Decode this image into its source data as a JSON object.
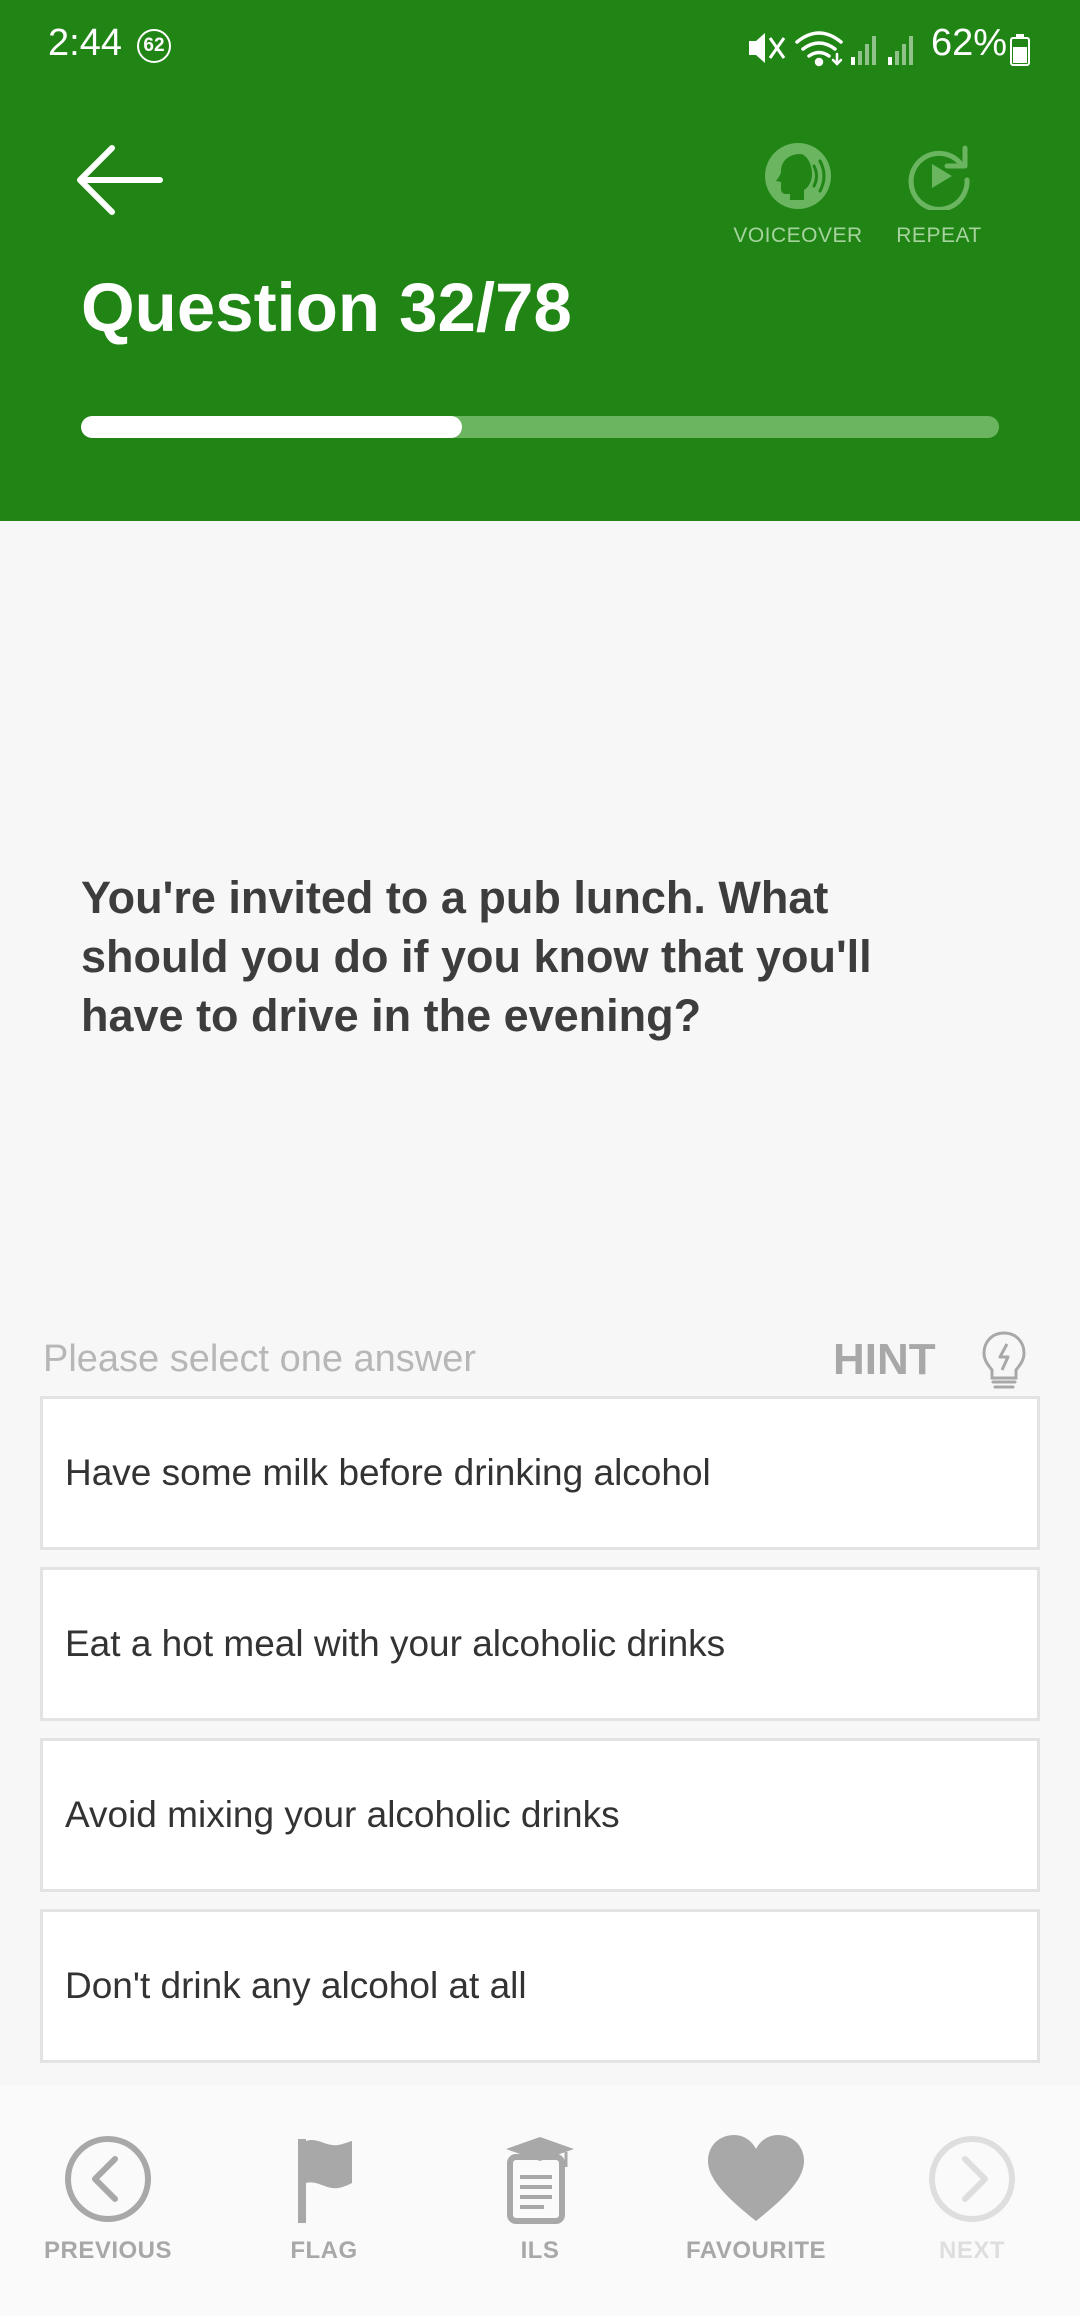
{
  "status_bar": {
    "time": "2:44",
    "notification_count": "62",
    "battery_percent": "62%"
  },
  "header": {
    "title": "Question 32/78",
    "voiceover_label": "VOICEOVER",
    "repeat_label": "REPEAT",
    "progress_fraction": 0.415,
    "background_color": "#208515"
  },
  "question": {
    "text": "You're invited to a pub lunch. What should you do if you know that you'll have to drive in the evening?"
  },
  "answers": {
    "instruction": "Please select one answer",
    "hint_label": "HINT",
    "options": [
      "Have some milk before drinking alcohol",
      "Eat a hot meal with your alcoholic drinks",
      "Avoid mixing your alcoholic drinks",
      "Don't drink any alcohol at all"
    ]
  },
  "bottom_nav": {
    "items": [
      {
        "label": "PREVIOUS",
        "icon": "chevron-left-circle-icon"
      },
      {
        "label": "FLAG",
        "icon": "flag-icon"
      },
      {
        "label": "ILS",
        "icon": "book-icon"
      },
      {
        "label": "FAVOURITE",
        "icon": "heart-icon"
      },
      {
        "label": "NEXT",
        "icon": "chevron-right-circle-icon",
        "disabled": true
      }
    ]
  }
}
